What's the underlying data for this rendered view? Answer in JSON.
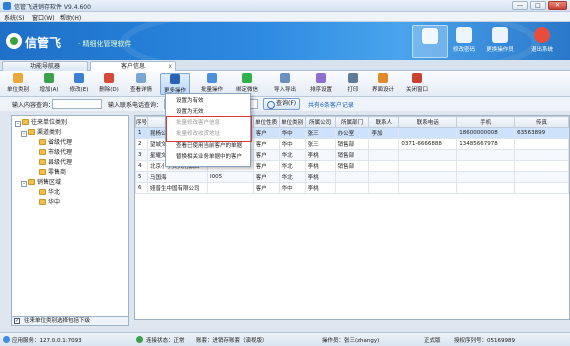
{
  "window": {
    "title": "信管飞进销存软件 V9.4.600",
    "minimize": "—",
    "maximize": "□",
    "close": "✕"
  },
  "menu": {
    "items": [
      "系统(S)",
      "窗口(W)",
      "帮助(H)"
    ]
  },
  "banner": {
    "brand": "信管飞",
    "slogan": "· 精细化管理软件",
    "buttons": [
      {
        "label": "",
        "icon": "list-icon"
      },
      {
        "label": "修改密码",
        "icon": "lock-icon"
      },
      {
        "label": "更换操作员",
        "icon": "users-icon"
      },
      {
        "label": "退出系统",
        "icon": "power-icon"
      }
    ]
  },
  "tabs": [
    {
      "label": "功能导航器"
    },
    {
      "label": "客户信息",
      "close": "x"
    }
  ],
  "toolbar": {
    "buttons": [
      {
        "label": "单位类别"
      },
      {
        "label": "增加(A)"
      },
      {
        "label": "修改(E)"
      },
      {
        "label": "删除(D)"
      },
      {
        "label": "查看详情"
      },
      {
        "label": "更多操作"
      },
      {
        "label": "批量操作"
      },
      {
        "label": "绑定微信"
      },
      {
        "label": "导入导出"
      },
      {
        "label": "排序设置"
      },
      {
        "label": "打印"
      },
      {
        "label": "界面设计"
      },
      {
        "label": "关闭窗口"
      }
    ]
  },
  "search": {
    "content_label": "输入内容查询：",
    "phone_label": "输入联系电话查询：",
    "query_button": "查询(F)",
    "result": "共有6条客户记录"
  },
  "dropdown": {
    "items": [
      {
        "label": "设置为有效",
        "disabled": false
      },
      {
        "label": "设置为无效",
        "disabled": false
      },
      {
        "label": "批量修改客户信息",
        "disabled": true
      },
      {
        "label": "批量修改收货地址",
        "disabled": true
      },
      {
        "label": "查看已使用当前客户的单据",
        "disabled": false
      },
      {
        "label": "替换相关业务单据中的客户",
        "disabled": false
      }
    ]
  },
  "tree": {
    "root": "往来单位类别",
    "nodes": [
      {
        "label": "渠道类别",
        "level": 1,
        "expand": "-"
      },
      {
        "label": "省级代理",
        "level": 2
      },
      {
        "label": "市级代理",
        "level": 2
      },
      {
        "label": "县级代理",
        "level": 2
      },
      {
        "label": "零售商",
        "level": 2
      },
      {
        "label": "销售区域",
        "level": 1,
        "expand": "-"
      },
      {
        "label": "华北",
        "level": 2
      },
      {
        "label": "华中",
        "level": 2
      }
    ],
    "footer_check": "✓",
    "footer_label": "往来单位类别选择包括下级"
  },
  "grid": {
    "columns": [
      "序号",
      "单位名称",
      "编号",
      "单位性质",
      "单位类别",
      "所属公司",
      "所属部门",
      "联系人",
      "联系电话",
      "手机",
      "传真"
    ],
    "rows": [
      [
        "1",
        "昆杨公司测试",
        "",
        "客户",
        "华中",
        "张三",
        "办公室",
        "李加",
        "",
        "18600000008",
        "63563899"
      ],
      [
        "2",
        "望城文具店",
        "",
        "客户",
        "华中",
        "张三",
        "销售部",
        "",
        "0371-6666888",
        "13485667978",
        ""
      ],
      [
        "3",
        "星耀文具用品",
        "",
        "客户",
        "华北",
        "李桃",
        "销售部",
        "",
        "",
        "",
        ""
      ],
      [
        "4",
        "北京小学文具用品店",
        "I004",
        "客户",
        "华北",
        "李桃",
        "销售部",
        "",
        "",
        "",
        ""
      ],
      [
        "5",
        "马国海",
        "I005",
        "客户",
        "华北",
        "李桃",
        "",
        "",
        "",
        "",
        ""
      ],
      [
        "6",
        "娅普生中国有限公司",
        "",
        "客户",
        "华中",
        "李桃",
        "",
        "",
        "",
        "",
        ""
      ]
    ]
  },
  "status": {
    "server": "应用服务：127.0.0.1:7093",
    "connect": "连接状态：正常",
    "account": "账套：进销存账套（演视版）",
    "operator": "操作员：张三(zhangy)",
    "edition": "正式版",
    "license": "授权序列号：05169989"
  },
  "colors": {
    "banner": "#2c8ae0",
    "accent": "#1b63b6",
    "highlight": "#d43a3a"
  }
}
